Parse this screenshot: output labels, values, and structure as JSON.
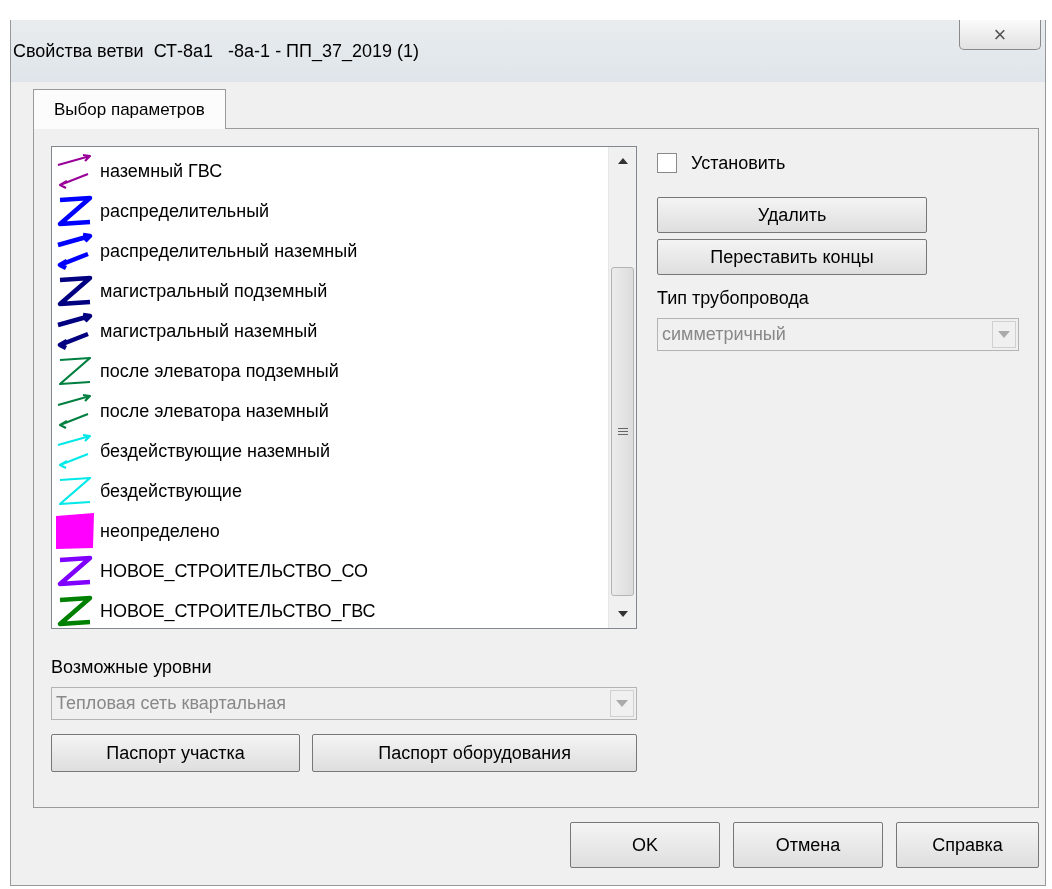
{
  "window": {
    "title": "Свойства ветви  СТ-8а1   -8а-1 - ПП_37_2019 (1)",
    "close": "×"
  },
  "tabs": [
    {
      "label": "Выбор параметров",
      "selected": true
    }
  ],
  "pipe_list": {
    "items": [
      {
        "label": "наземный ГВС",
        "kind": "arrows",
        "color": "#990099"
      },
      {
        "label": "распределительный",
        "kind": "boldzigzag",
        "color": "#0000ff"
      },
      {
        "label": "распределительный наземный",
        "kind": "boldarrows",
        "color": "#0000ff"
      },
      {
        "label": "магистральный подземный",
        "kind": "boldzigzag",
        "color": "#000080"
      },
      {
        "label": "магистральный наземный",
        "kind": "boldarrows",
        "color": "#000080"
      },
      {
        "label": "после элеватора подземный",
        "kind": "zigzag",
        "color": "#008040"
      },
      {
        "label": "после элеватора наземный",
        "kind": "arrows",
        "color": "#008040"
      },
      {
        "label": "бездействующие наземный",
        "kind": "arrows",
        "color": "#00e8e8"
      },
      {
        "label": "бездействующие",
        "kind": "zigzag",
        "color": "#00e8e8"
      },
      {
        "label": "неопределено",
        "kind": "blob",
        "color": "#ff00ff"
      },
      {
        "label": "НОВОЕ_СТРОИТЕЛЬСТВО_СО",
        "kind": "boldzigzag",
        "color": "#8000ff"
      },
      {
        "label": "НОВОЕ_СТРОИТЕЛЬСТВО_ГВС",
        "kind": "boldzigzag",
        "color": "#008000"
      }
    ]
  },
  "install_checkbox": {
    "label": "Установить",
    "checked": false
  },
  "right_buttons": [
    "Удалить",
    "Переставить концы"
  ],
  "pipe_type": {
    "label": "Тип трубопровода",
    "value": "симметричный",
    "disabled": true
  },
  "levels": {
    "label": "Возможные уровни",
    "value": "Тепловая сеть квартальная",
    "disabled": true
  },
  "passport_buttons": [
    "Паспорт участка",
    "Паспорт оборудования"
  ],
  "dialog_buttons": [
    "OK",
    "Отмена",
    "Справка"
  ]
}
